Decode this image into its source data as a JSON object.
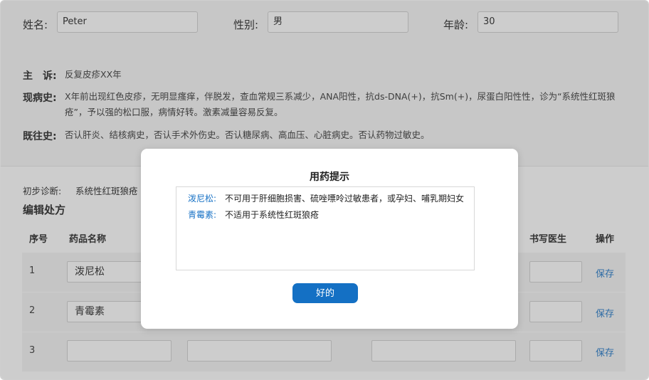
{
  "patient": {
    "name_label": "姓名:",
    "name_value": "Peter",
    "gender_label": "性别:",
    "gender_value": "男",
    "age_label": "年龄:",
    "age_value": "30"
  },
  "history": {
    "chief_label": "主　诉:",
    "chief_text": "反复皮疹XX年",
    "present_label": "现病史:",
    "present_text": "X年前出现红色皮疹，无明显瘙痒，伴脱发，查血常规三系减少，ANA阳性，抗ds-DNA(+)，抗Sm(+)，尿蛋白阳性性，诊为“系统性红斑狼疮”，予以强的松口服，病情好转。激素减量容易反复。",
    "past_label": "既往史:",
    "past_text": "否认肝炎、结核病史，否认手术外伤史。否认糖尿病、高血压、心脏病史。否认药物过敏史。"
  },
  "diagnosis": {
    "label": "初步诊断:",
    "value": "系统性红斑狼疮"
  },
  "prescription": {
    "title": "编辑处方",
    "headers": {
      "no": "序号",
      "drug": "药品名称",
      "doctor": "书写医生",
      "action": "操作"
    },
    "rows": [
      {
        "no": "1",
        "drug": "泼尼松",
        "action": "保存"
      },
      {
        "no": "2",
        "drug": "青霉素",
        "action": "保存"
      },
      {
        "no": "3",
        "drug": "",
        "action": "保存"
      }
    ]
  },
  "modal": {
    "title": "用药提示",
    "tips": [
      {
        "drug": "泼尼松:",
        "message": "不可用于肝细胞损害、硫唑嘌呤过敏患者，或孕妇、哺乳期妇女"
      },
      {
        "drug": "青霉素:",
        "message": "不适用于系统性红斑狼疮"
      }
    ],
    "ok_label": "好的"
  },
  "colors": {
    "accent": "#1470c4",
    "link": "#1a73c6",
    "overlay": "rgba(90,90,90,0.30)"
  }
}
